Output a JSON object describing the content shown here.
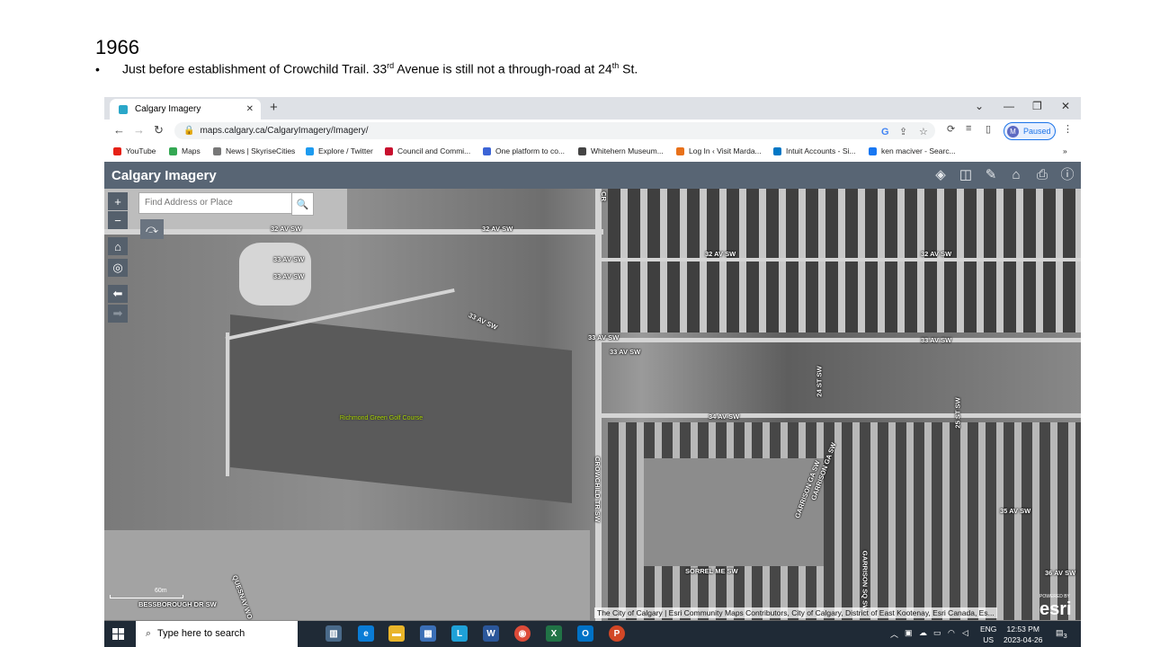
{
  "slide": {
    "title": "1966",
    "bullet_marker": "•",
    "bullet_parts": [
      "Just before establishment of Crowchild Trail.  33",
      "rd",
      " Avenue is still not a through-road  at 24",
      "th",
      " St."
    ]
  },
  "browser": {
    "tab_title": "Calgary Imagery",
    "url": "maps.calgary.ca/CalgaryImagery/Imagery/",
    "profile_initial": "M",
    "profile_status": "Paused",
    "bookmarks": [
      {
        "label": "YouTube",
        "color": "#e62117"
      },
      {
        "label": "Maps",
        "color": "#34a853"
      },
      {
        "label": "News | SkyriseCities",
        "color": "#777777"
      },
      {
        "label": "Explore / Twitter",
        "color": "#1d9bf0"
      },
      {
        "label": "Council and Commi...",
        "color": "#c8102e"
      },
      {
        "label": "One platform to co...",
        "color": "#3c64d6"
      },
      {
        "label": "Whitehern Museum...",
        "color": "#444444"
      },
      {
        "label": "Log In ‹ Visit Marda...",
        "color": "#e8711a"
      },
      {
        "label": "Intuit Accounts - Si...",
        "color": "#0077c5"
      },
      {
        "label": "ken maciver - Searc...",
        "color": "#1877f2"
      }
    ],
    "more_bookmarks": "»"
  },
  "app": {
    "title": "Calgary Imagery",
    "search_placeholder": "Find Address or Place"
  },
  "map": {
    "labels": [
      "32 AV SW",
      "32 AV SW",
      "33 AV SW",
      "33 AV SW",
      "33 AV SW",
      "33 AV SW",
      "33 AV SW",
      "32 AV SW",
      "32 AV SW",
      "33 AV SW",
      "34 AV SW",
      "24 ST SW",
      "25 ST SW",
      "35 AV SW",
      "36 AV SW",
      "SORREL ME SW",
      "GARRISON GA SW",
      "GARRISON GA SW",
      "GARRISON SQ SW",
      "CROWCHILD TR SW",
      "QUESNAY WO",
      "BESSBOROUGH DR SW",
      "CR"
    ],
    "poi": "Richmond Green Golf Course",
    "scale_label": "60m",
    "attribution": "The City of Calgary | Esri Community Maps Contributors, City of Calgary, District of East Kootenay, Esri Canada, Es...",
    "powered_by": "POWERED BY",
    "esri": "esri"
  },
  "taskbar": {
    "search_placeholder": "Type here to search",
    "lang_top": "ENG",
    "lang_bottom": "US",
    "time": "12:53 PM",
    "date": "2023-04-26",
    "notifications": "3"
  },
  "colors": {
    "app_header": "#586574",
    "taskbar": "#1f2a36",
    "poi_text": "#a8d400"
  }
}
